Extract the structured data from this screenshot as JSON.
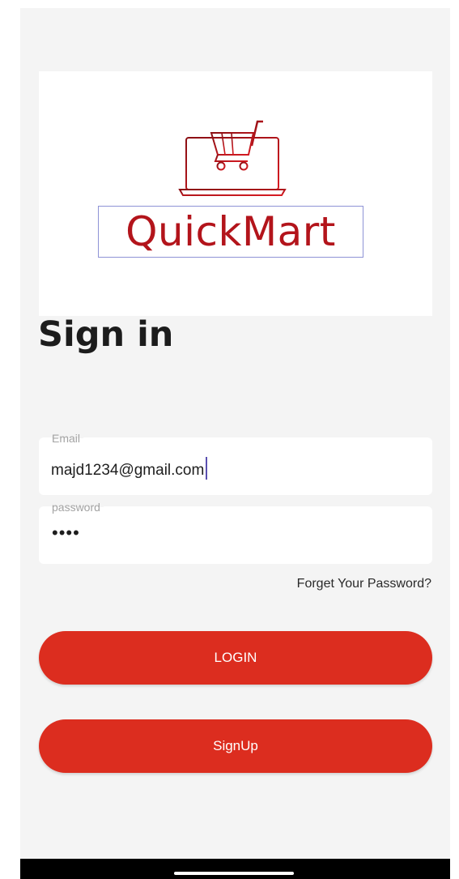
{
  "logo": {
    "brand_text": "QuickMart",
    "icon": "laptop-cart-icon",
    "color": "#b3141b"
  },
  "title": "Sign in",
  "form": {
    "email": {
      "label": "Email",
      "value": "majd1234@gmail.com"
    },
    "password": {
      "label": "password",
      "masked_value": "••••"
    },
    "forgot_password": "Forget Your Password?"
  },
  "buttons": {
    "login": "LOGIN",
    "signup": "SignUp",
    "accent": "#dc2d1f"
  },
  "system": {
    "nav_bar_color": "#000000"
  }
}
